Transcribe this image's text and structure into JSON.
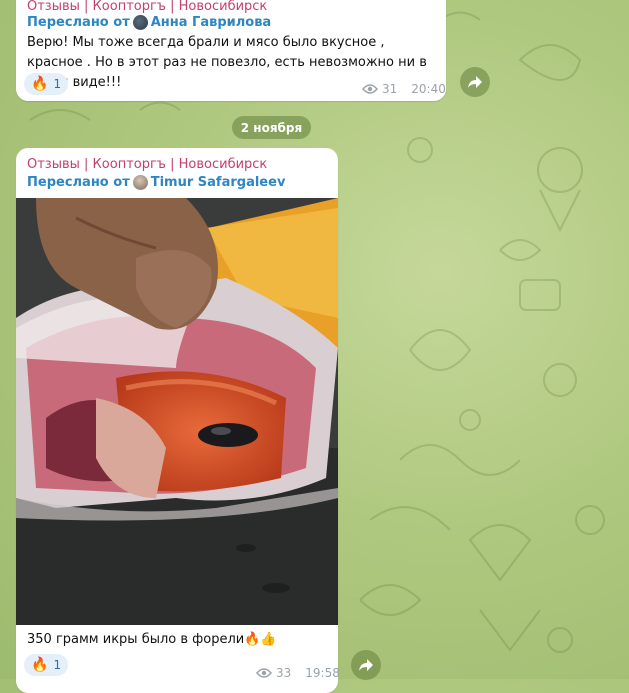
{
  "msg1": {
    "channel": "Отзывы | Коопторгъ | Новосибирск",
    "forward_prefix": "Переслано от",
    "forward_from": "Анна Гаврилова",
    "text": "Верю! Мы тоже всегда брали и мясо было вкусное , красное . Но в этот раз не повезло, есть невозможно ни в каком виде!!!",
    "reaction_count": "1",
    "views": "31",
    "time": "20:40"
  },
  "date_separator": "2 ноября",
  "msg2": {
    "channel": "Отзывы | Коопторгъ | Новосибирск",
    "forward_prefix": "Переслано от",
    "forward_from": "Timur Safargaleev",
    "caption": "350 грамм икры было в форели🔥👍",
    "reaction_count": "1",
    "views": "33",
    "time": "19:58"
  },
  "icons": {
    "reaction": "fire-icon",
    "views": "eye-icon",
    "share": "share-arrow-icon"
  },
  "colors": {
    "channel_name": "#c4406a",
    "forward_name": "#2e86c1",
    "background": "#afc87f",
    "reaction_bg": "#e4effa",
    "caviar": "#d9532a"
  }
}
